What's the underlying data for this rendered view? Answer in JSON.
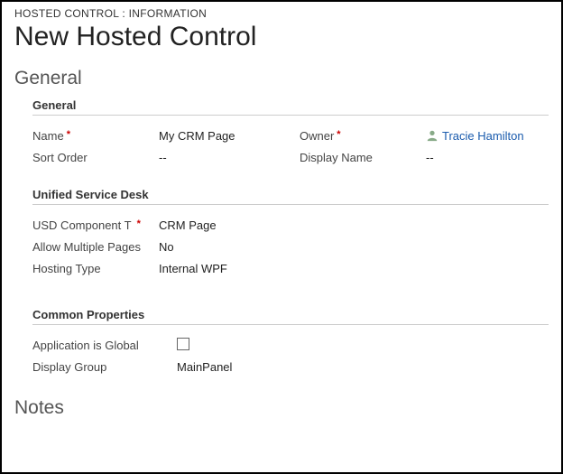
{
  "breadcrumb": "HOSTED CONTROL : INFORMATION",
  "page_title": "New Hosted Control",
  "section_general": "General",
  "groups": {
    "general": {
      "heading": "General",
      "name_label": "Name",
      "name_value": "My CRM Page",
      "sort_order_label": "Sort Order",
      "sort_order_value": "--",
      "owner_label": "Owner",
      "owner_value": "Tracie Hamilton",
      "display_name_label": "Display Name",
      "display_name_value": "--"
    },
    "usd": {
      "heading": "Unified Service Desk",
      "component_type_label": "USD Component T",
      "component_type_value": "CRM Page",
      "allow_multiple_label": "Allow Multiple Pages",
      "allow_multiple_value": "No",
      "hosting_type_label": "Hosting Type",
      "hosting_type_value": "Internal WPF"
    },
    "common": {
      "heading": "Common Properties",
      "app_is_global_label": "Application is Global",
      "app_is_global_checked": false,
      "display_group_label": "Display Group",
      "display_group_value": "MainPanel"
    }
  },
  "section_notes": "Notes"
}
